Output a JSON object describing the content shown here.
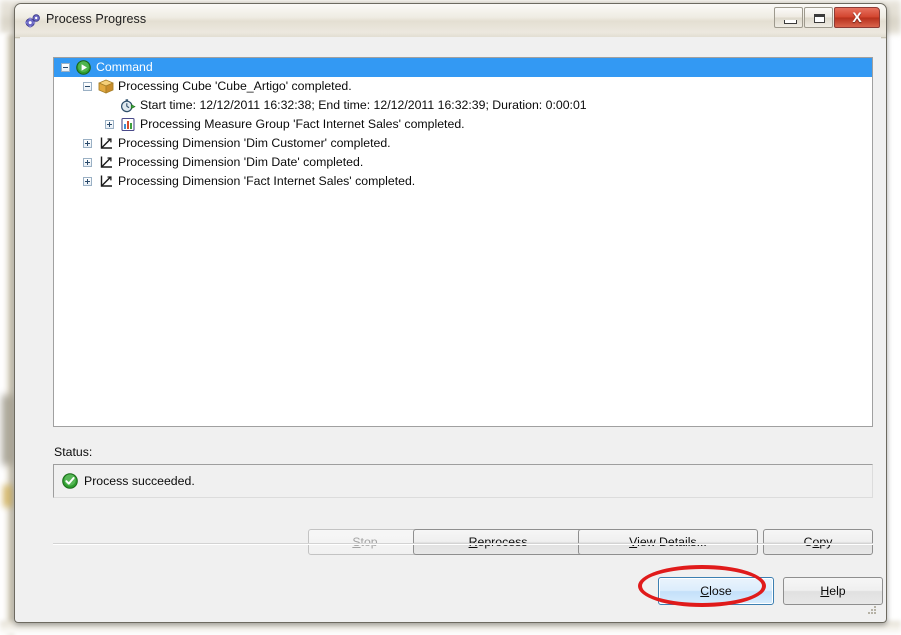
{
  "window": {
    "title": "Process Progress",
    "icon": "gear-icon",
    "controls": {
      "minimize": "minimize-icon",
      "maximize": "maximize-icon",
      "close": "close-icon",
      "close_glyph": "X"
    }
  },
  "tree": {
    "items": [
      {
        "label": "Command",
        "icon": "green-play-icon",
        "expander": "minus",
        "indent": 0,
        "selected": true
      },
      {
        "label": "Processing Cube 'Cube_Artigo' completed.",
        "icon": "cube-icon",
        "expander": "minus",
        "indent": 1,
        "selected": false
      },
      {
        "label": "Start time: 12/12/2011 16:32:38; End time: 12/12/2011 16:32:39; Duration: 0:00:01",
        "icon": "stopwatch-icon",
        "expander": "none",
        "indent": 2,
        "selected": false
      },
      {
        "label": "Processing Measure Group 'Fact Internet Sales' completed.",
        "icon": "bar-chart-icon",
        "expander": "plus",
        "indent": 2,
        "selected": false
      },
      {
        "label": "Processing Dimension 'Dim Customer' completed.",
        "icon": "dimension-axes-icon",
        "expander": "plus",
        "indent": 1,
        "selected": false
      },
      {
        "label": "Processing Dimension 'Dim Date' completed.",
        "icon": "dimension-axes-icon",
        "expander": "plus",
        "indent": 1,
        "selected": false
      },
      {
        "label": "Processing Dimension 'Fact Internet Sales' completed.",
        "icon": "dimension-axes-icon",
        "expander": "plus",
        "indent": 1,
        "selected": false
      }
    ]
  },
  "status": {
    "label": "Status:",
    "icon": "success-check-icon",
    "message": "Process succeeded."
  },
  "buttons": {
    "stop": {
      "label": "Stop",
      "accel": "S",
      "disabled": true
    },
    "reprocess": {
      "label": "Reprocess",
      "accel": "R",
      "disabled": false
    },
    "view_details": {
      "label": "View Details...",
      "accel": "V",
      "disabled": false
    },
    "copy": {
      "label": "Copy",
      "accel": "C",
      "disabled": false
    },
    "close": {
      "label": "Close",
      "accel": "C",
      "disabled": false,
      "default": true
    },
    "help": {
      "label": "Help",
      "accel": "H",
      "disabled": false
    }
  },
  "annotation": {
    "shape": "ellipse",
    "color": "#e01b1b",
    "target": "close-button"
  },
  "colors": {
    "selection": "#3399f3",
    "dialog_face": "#f0f0f0",
    "titlebar": "#e8e4da",
    "close_button_red": "#c8341f",
    "annotation_red": "#e01b1b"
  }
}
